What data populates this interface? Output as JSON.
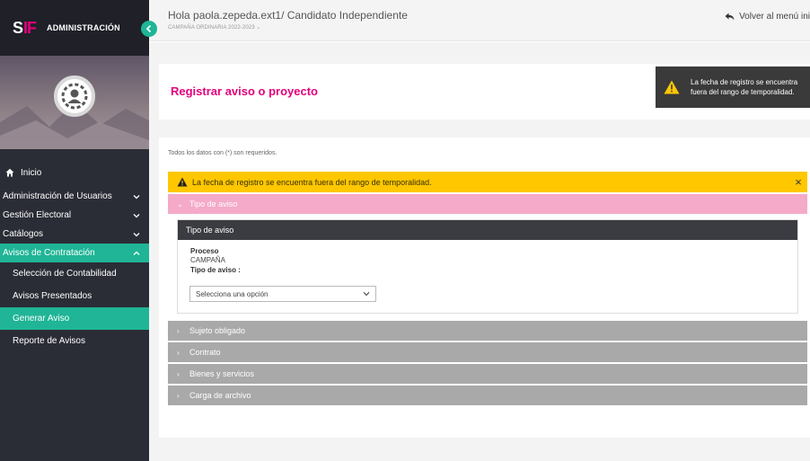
{
  "sidebar": {
    "admin_label": "ADMINISTRACIÓN",
    "logo": "SIF",
    "items": [
      {
        "label": "Inicio"
      },
      {
        "label": "Administración de Usuarios"
      },
      {
        "label": "Gestión Electoral"
      },
      {
        "label": "Catálogos"
      },
      {
        "label": "Avisos de Contratación"
      }
    ],
    "subitems": [
      {
        "label": "Selección de Contabilidad"
      },
      {
        "label": "Avisos Presentados"
      },
      {
        "label": "Generar Aviso"
      },
      {
        "label": "Reporte de Avisos"
      }
    ],
    "accent_color": "#1fb596"
  },
  "topbar": {
    "greeting": "Hola paola.zepeda.ext1/ Candidato Independiente",
    "campaign": "CAMPAÑA ORDINARIA 2022-2023 ⌄",
    "back_label": "Volver al menú ini"
  },
  "main": {
    "page_title": "Registrar aviso o proyecto",
    "required_note": "Todos los datos con (*) son requeridos.",
    "warning": "La fecha de registro se encuentra fuera del rango de temporalidad.",
    "close_glyph": "×",
    "sections": [
      {
        "label": "Tipo de aviso",
        "arrow": "⌄"
      },
      {
        "label": "Sujeto obligado",
        "arrow": "›"
      },
      {
        "label": "Contrato",
        "arrow": "›"
      },
      {
        "label": "Bienes y servicios",
        "arrow": "›"
      },
      {
        "label": "Carga de archivo",
        "arrow": "›"
      }
    ],
    "panel": {
      "header": "Tipo de aviso",
      "proceso_label": "Proceso",
      "proceso_value": "CAMPAÑA",
      "tipo_label": "Tipo de aviso :",
      "select_value": "Selecciona una opción"
    },
    "brand_color": "#e4007c",
    "warning_color": "#ffc700"
  },
  "toast": {
    "text": "La fecha de registro se encuentra fuera del rango de temporalidad."
  }
}
